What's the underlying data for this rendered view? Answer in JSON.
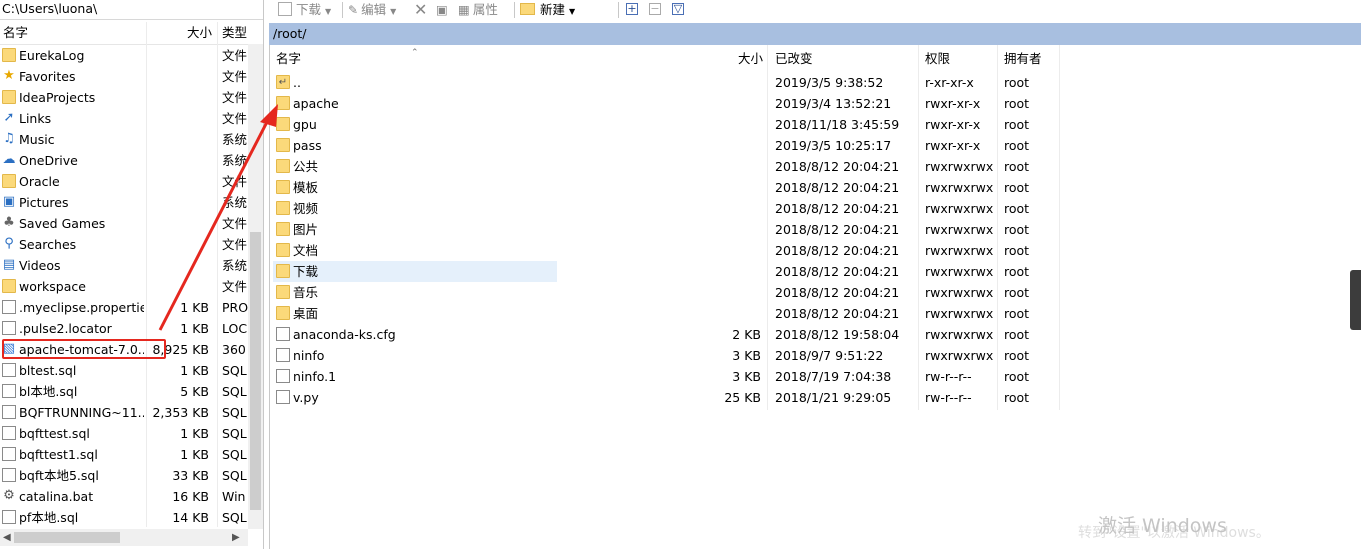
{
  "left_pane": {
    "path": "C:\\Users\\luona\\",
    "columns": {
      "name": "名字",
      "size": "大小",
      "type": "类型"
    },
    "items": [
      {
        "name": "EurekaLog",
        "size": "",
        "type": "文件",
        "icon": "folder-icon"
      },
      {
        "name": "Favorites",
        "size": "",
        "type": "文件",
        "icon": "star-icon"
      },
      {
        "name": "IdeaProjects",
        "size": "",
        "type": "文件",
        "icon": "folder-icon"
      },
      {
        "name": "Links",
        "size": "",
        "type": "文件",
        "icon": "links-icon"
      },
      {
        "name": "Music",
        "size": "",
        "type": "系统",
        "icon": "music-icon"
      },
      {
        "name": "OneDrive",
        "size": "",
        "type": "系统",
        "icon": "cloud-icon"
      },
      {
        "name": "Oracle",
        "size": "",
        "type": "文件",
        "icon": "folder-icon"
      },
      {
        "name": "Pictures",
        "size": "",
        "type": "系统",
        "icon": "pictures-icon"
      },
      {
        "name": "Saved Games",
        "size": "",
        "type": "文件",
        "icon": "games-icon"
      },
      {
        "name": "Searches",
        "size": "",
        "type": "文件",
        "icon": "search-icon"
      },
      {
        "name": "Videos",
        "size": "",
        "type": "系统",
        "icon": "videos-icon"
      },
      {
        "name": "workspace",
        "size": "",
        "type": "文件",
        "icon": "folder-icon"
      },
      {
        "name": ".myeclipse.properties",
        "size": "1 KB",
        "type": "PRO",
        "icon": "file-icon"
      },
      {
        "name": ".pulse2.locator",
        "size": "1 KB",
        "type": "LOC",
        "icon": "file-icon"
      },
      {
        "name": "apache-tomcat-7.0....",
        "size": "8,925 KB",
        "type": "360",
        "icon": "archive-icon"
      },
      {
        "name": "bltest.sql",
        "size": "1 KB",
        "type": "SQL",
        "icon": "file-icon"
      },
      {
        "name": "bl本地.sql",
        "size": "5 KB",
        "type": "SQL",
        "icon": "file-icon"
      },
      {
        "name": "BQFTRUNNING~11...",
        "size": "2,353 KB",
        "type": "SQL",
        "icon": "file-icon"
      },
      {
        "name": "bqfttest.sql",
        "size": "1 KB",
        "type": "SQL",
        "icon": "file-icon"
      },
      {
        "name": "bqfttest1.sql",
        "size": "1 KB",
        "type": "SQL",
        "icon": "file-icon"
      },
      {
        "name": "bqft本地5.sql",
        "size": "33 KB",
        "type": "SQL",
        "icon": "file-icon"
      },
      {
        "name": "catalina.bat",
        "size": "16 KB",
        "type": "Win",
        "icon": "bat-icon"
      },
      {
        "name": "pf本地.sql",
        "size": "14 KB",
        "type": "SQL",
        "icon": "file-icon"
      }
    ]
  },
  "toolbar": {
    "download": "下载",
    "edit": "编辑",
    "properties": "属性",
    "new": "新建"
  },
  "right_pane": {
    "path": "/root/",
    "columns": {
      "name": "名字",
      "size": "大小",
      "modified": "已改变",
      "permissions": "权限",
      "owner": "拥有者"
    },
    "items": [
      {
        "name": "..",
        "size": "",
        "modified": "2019/3/5 9:38:52",
        "permissions": "r-xr-xr-x",
        "owner": "root",
        "icon": "parent-dir-icon"
      },
      {
        "name": "apache",
        "size": "",
        "modified": "2019/3/4 13:52:21",
        "permissions": "rwxr-xr-x",
        "owner": "root",
        "icon": "folder-icon"
      },
      {
        "name": "gpu",
        "size": "",
        "modified": "2018/11/18 3:45:59",
        "permissions": "rwxr-xr-x",
        "owner": "root",
        "icon": "folder-icon"
      },
      {
        "name": "pass",
        "size": "",
        "modified": "2019/3/5 10:25:17",
        "permissions": "rwxr-xr-x",
        "owner": "root",
        "icon": "folder-icon"
      },
      {
        "name": "公共",
        "size": "",
        "modified": "2018/8/12 20:04:21",
        "permissions": "rwxrwxrwx",
        "owner": "root",
        "icon": "folder-icon"
      },
      {
        "name": "模板",
        "size": "",
        "modified": "2018/8/12 20:04:21",
        "permissions": "rwxrwxrwx",
        "owner": "root",
        "icon": "folder-icon"
      },
      {
        "name": "视频",
        "size": "",
        "modified": "2018/8/12 20:04:21",
        "permissions": "rwxrwxrwx",
        "owner": "root",
        "icon": "folder-icon"
      },
      {
        "name": "图片",
        "size": "",
        "modified": "2018/8/12 20:04:21",
        "permissions": "rwxrwxrwx",
        "owner": "root",
        "icon": "folder-icon"
      },
      {
        "name": "文档",
        "size": "",
        "modified": "2018/8/12 20:04:21",
        "permissions": "rwxrwxrwx",
        "owner": "root",
        "icon": "folder-icon"
      },
      {
        "name": "下载",
        "size": "",
        "modified": "2018/8/12 20:04:21",
        "permissions": "rwxrwxrwx",
        "owner": "root",
        "icon": "folder-icon"
      },
      {
        "name": "音乐",
        "size": "",
        "modified": "2018/8/12 20:04:21",
        "permissions": "rwxrwxrwx",
        "owner": "root",
        "icon": "folder-icon"
      },
      {
        "name": "桌面",
        "size": "",
        "modified": "2018/8/12 20:04:21",
        "permissions": "rwxrwxrwx",
        "owner": "root",
        "icon": "folder-icon"
      },
      {
        "name": "anaconda-ks.cfg",
        "size": "2 KB",
        "modified": "2018/8/12 19:58:04",
        "permissions": "rwxrwxrwx",
        "owner": "root",
        "icon": "file-icon"
      },
      {
        "name": "ninfo",
        "size": "3 KB",
        "modified": "2018/9/7 9:51:22",
        "permissions": "rwxrwxrwx",
        "owner": "root",
        "icon": "file-icon"
      },
      {
        "name": "ninfo.1",
        "size": "3 KB",
        "modified": "2018/7/19 7:04:38",
        "permissions": "rw-r--r--",
        "owner": "root",
        "icon": "file-icon"
      },
      {
        "name": "v.py",
        "size": "25 KB",
        "modified": "2018/1/21 9:29:05",
        "permissions": "rw-r--r--",
        "owner": "root",
        "icon": "file-icon"
      }
    ]
  },
  "watermark": {
    "line1": "激活 Windows",
    "line2": "转到\"设置\"以激活 Windows。",
    "blog": "https://blog.csdn.net/weixin_43943355"
  },
  "colors": {
    "path_bar": "#a8bfe0",
    "folder": "#fbd97a",
    "annotation_red": "#e5281f",
    "selected_row": "#e5f0fb"
  }
}
